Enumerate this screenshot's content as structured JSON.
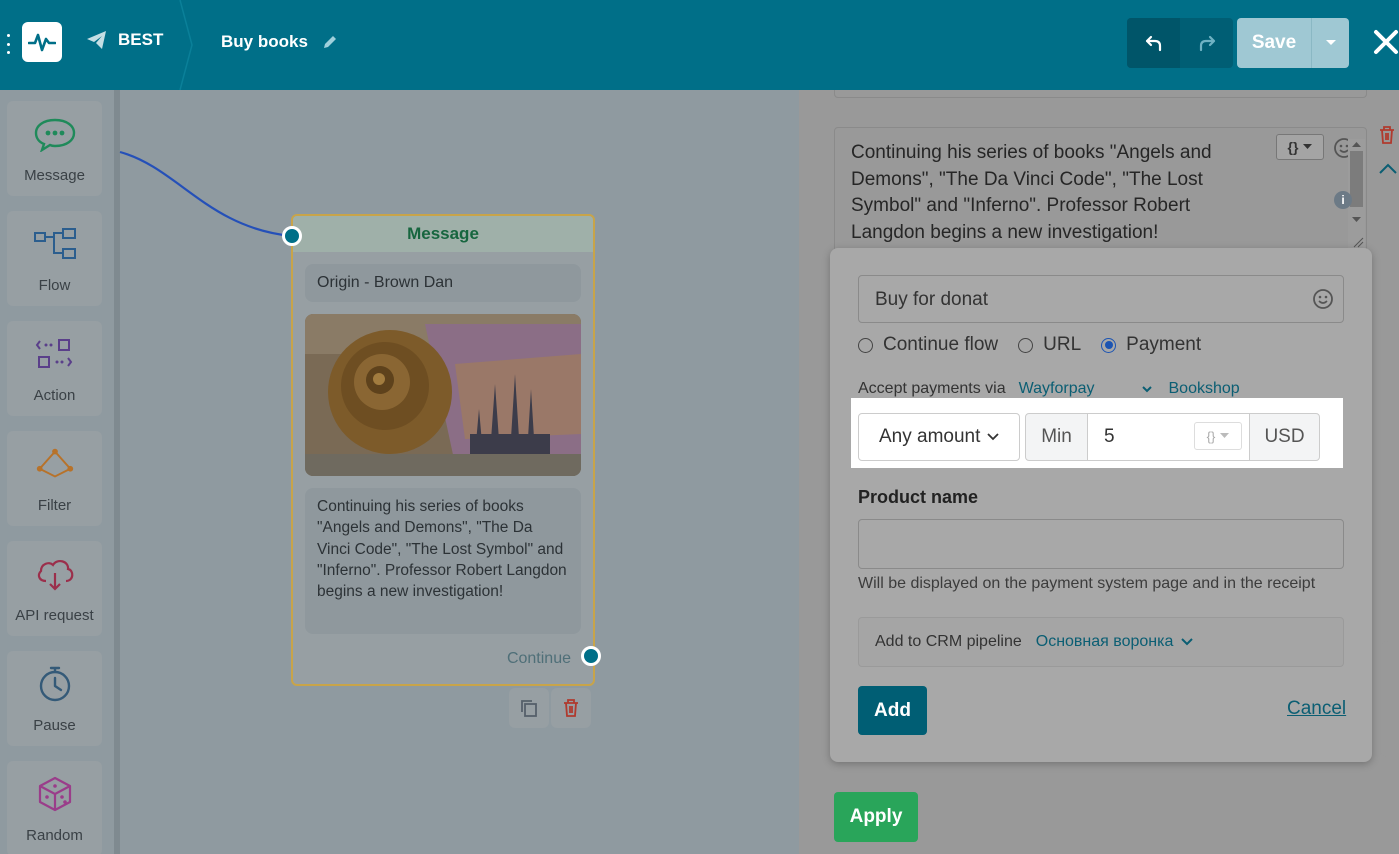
{
  "header": {
    "bot_name": "BEST",
    "flow_name": "Buy books",
    "save_label": "Save"
  },
  "sidebar": {
    "items": [
      {
        "label": "Message",
        "icon": "chat-bubble-icon"
      },
      {
        "label": "Flow",
        "icon": "flow-icon"
      },
      {
        "label": "Action",
        "icon": "action-icon"
      },
      {
        "label": "Filter",
        "icon": "filter-icon"
      },
      {
        "label": "API request",
        "icon": "api-cloud-icon"
      },
      {
        "label": "Pause",
        "icon": "timer-icon"
      },
      {
        "label": "Random",
        "icon": "dice-icon"
      }
    ]
  },
  "node": {
    "title": "Message",
    "origin": "Origin - Brown Dan",
    "text": "Continuing his series of books \"Angels and Demons\", \"The Da Vinci Code\", \"The Lost Symbol\" and \"Inferno\". Professor Robert Langdon begins a new investigation!",
    "continue_label": "Continue"
  },
  "editor": {
    "message_text": "Continuing his series of books \"Angels and Demons\", \"The Da Vinci Code\", \"The Lost Symbol\" and \"Inferno\". Professor Robert Langdon begins a new investigation!",
    "apply_label": "Apply",
    "button": {
      "text_value": "Buy for donat",
      "actions": [
        {
          "label": "Continue flow",
          "selected": false
        },
        {
          "label": "URL",
          "selected": false
        },
        {
          "label": "Payment",
          "selected": true
        }
      ],
      "accept_label": "Accept payments via",
      "provider": "Wayforpay",
      "shop": "Bookshop",
      "amount_type": "Any amount",
      "min_label": "Min",
      "min_value": "5",
      "currency": "USD",
      "product_label": "Product name",
      "product_value": "",
      "product_hint": "Will be displayed on the payment system page and in the receipt",
      "crm_label": "Add to CRM pipeline",
      "crm_value": "Основная воронка",
      "add_label": "Add",
      "cancel_label": "Cancel"
    }
  },
  "colors": {
    "header": "#006f88",
    "accent": "#0b5e73",
    "apply": "#29a55a",
    "radio_selected": "#1c54b2",
    "node_border": "#c8a449"
  }
}
